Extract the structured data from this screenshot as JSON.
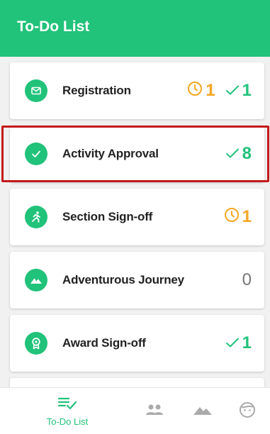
{
  "header": {
    "title": "To-Do List"
  },
  "items": [
    {
      "label": "Registration",
      "icon": "mail-icon",
      "pending": "1",
      "done": "1"
    },
    {
      "label": "Activity Approval",
      "icon": "check-icon",
      "done": "8"
    },
    {
      "label": "Section Sign-off",
      "icon": "runner-icon",
      "pending": "1"
    },
    {
      "label": "Adventurous Journey",
      "icon": "mountain-icon",
      "count": "0"
    },
    {
      "label": "Award Sign-off",
      "icon": "award-icon",
      "done": "1"
    }
  ],
  "bottom_nav": {
    "todo_label": "To-Do List",
    "items": [
      "todo-list-icon",
      "people-icon",
      "mountain-icon",
      "face-icon"
    ]
  },
  "colors": {
    "accent": "#21c27a",
    "pending": "#f5a623",
    "highlight": "#c41a1a"
  }
}
